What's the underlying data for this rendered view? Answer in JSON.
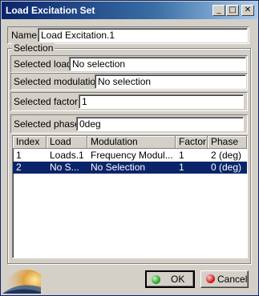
{
  "window": {
    "title": "Load Excitation Set",
    "controls": {
      "minimize": "_",
      "maximize": "□",
      "close": "✕"
    }
  },
  "name_field": {
    "label": "Name",
    "value": "Load Excitation.1"
  },
  "selection": {
    "legend": "Selection",
    "load": {
      "label": "Selected load:",
      "value": "No selection"
    },
    "modulation": {
      "label": "Selected modulation:",
      "value": "No selection"
    },
    "factor": {
      "label": "Selected factor:",
      "value": "1"
    },
    "phase": {
      "label": "Selected phase:",
      "value": "0deg"
    }
  },
  "table": {
    "columns": [
      "Index",
      "Load",
      "Modulation",
      "Factor",
      "Phase"
    ],
    "rows": [
      [
        "1",
        "Loads.1",
        "Frequency Modul...",
        "1",
        "2 (deg)"
      ],
      [
        "2",
        "No S...",
        "No Selection",
        "1",
        "0 (deg)"
      ]
    ],
    "selected_row": 1
  },
  "buttons": {
    "ok": "OK",
    "cancel": "Cancel"
  },
  "colors": {
    "selection": "#0a246a",
    "ok_icon": "#2fa82f",
    "cancel_icon": "#d42020"
  }
}
